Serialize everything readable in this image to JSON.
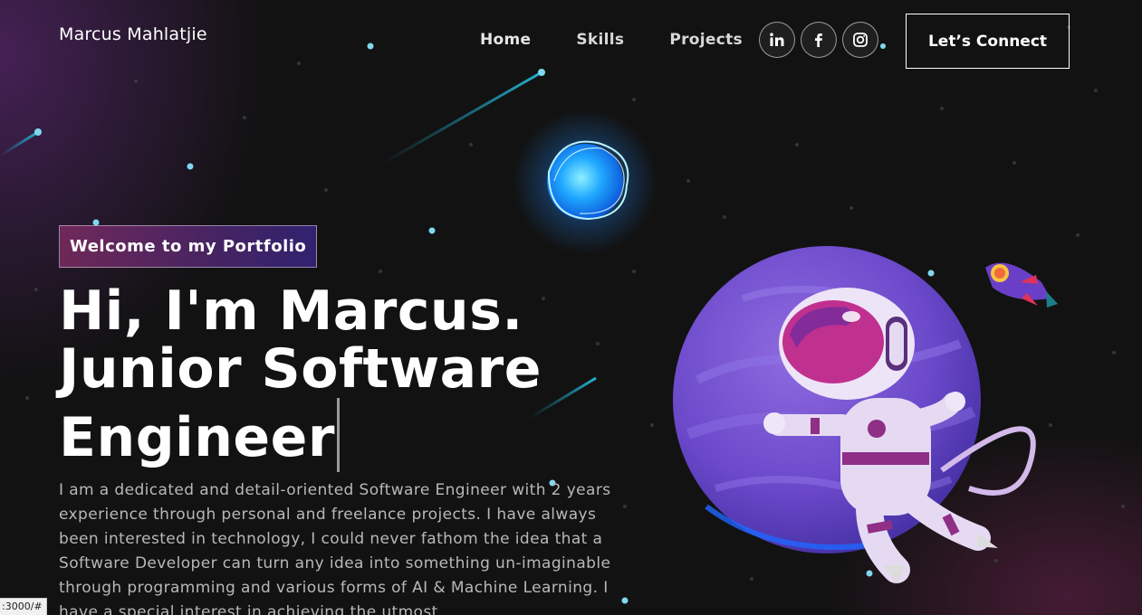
{
  "navbar": {
    "brand": "Marcus Mahlatjie",
    "links": [
      "Home",
      "Skills",
      "Projects"
    ],
    "socials": [
      "linkedin-icon",
      "facebook-icon",
      "instagram-icon"
    ],
    "connect_label": "Let’s Connect"
  },
  "hero": {
    "tagline": "Welcome to my Portfolio",
    "headline_lines": [
      "Hi, I'm Marcus.",
      "Junior Software",
      "Engineer"
    ],
    "intro": "I am a dedicated and detail-oriented Software Engineer with 2 years experience through personal and freelance projects. I have always been interested in technology, I could never fathom the idea that a Software Developer can turn any idea into something un-imaginable through programming and various forms of AI & Machine Learning. I have a special interest in achieving the utmost"
  },
  "status_bar": {
    "url": ":3000/#"
  },
  "colors": {
    "background": "#121212",
    "accent_pink": "#AA367C",
    "accent_purple": "#4A2FBD",
    "planet": "#6a48c9",
    "star": "#7fd8f0"
  }
}
